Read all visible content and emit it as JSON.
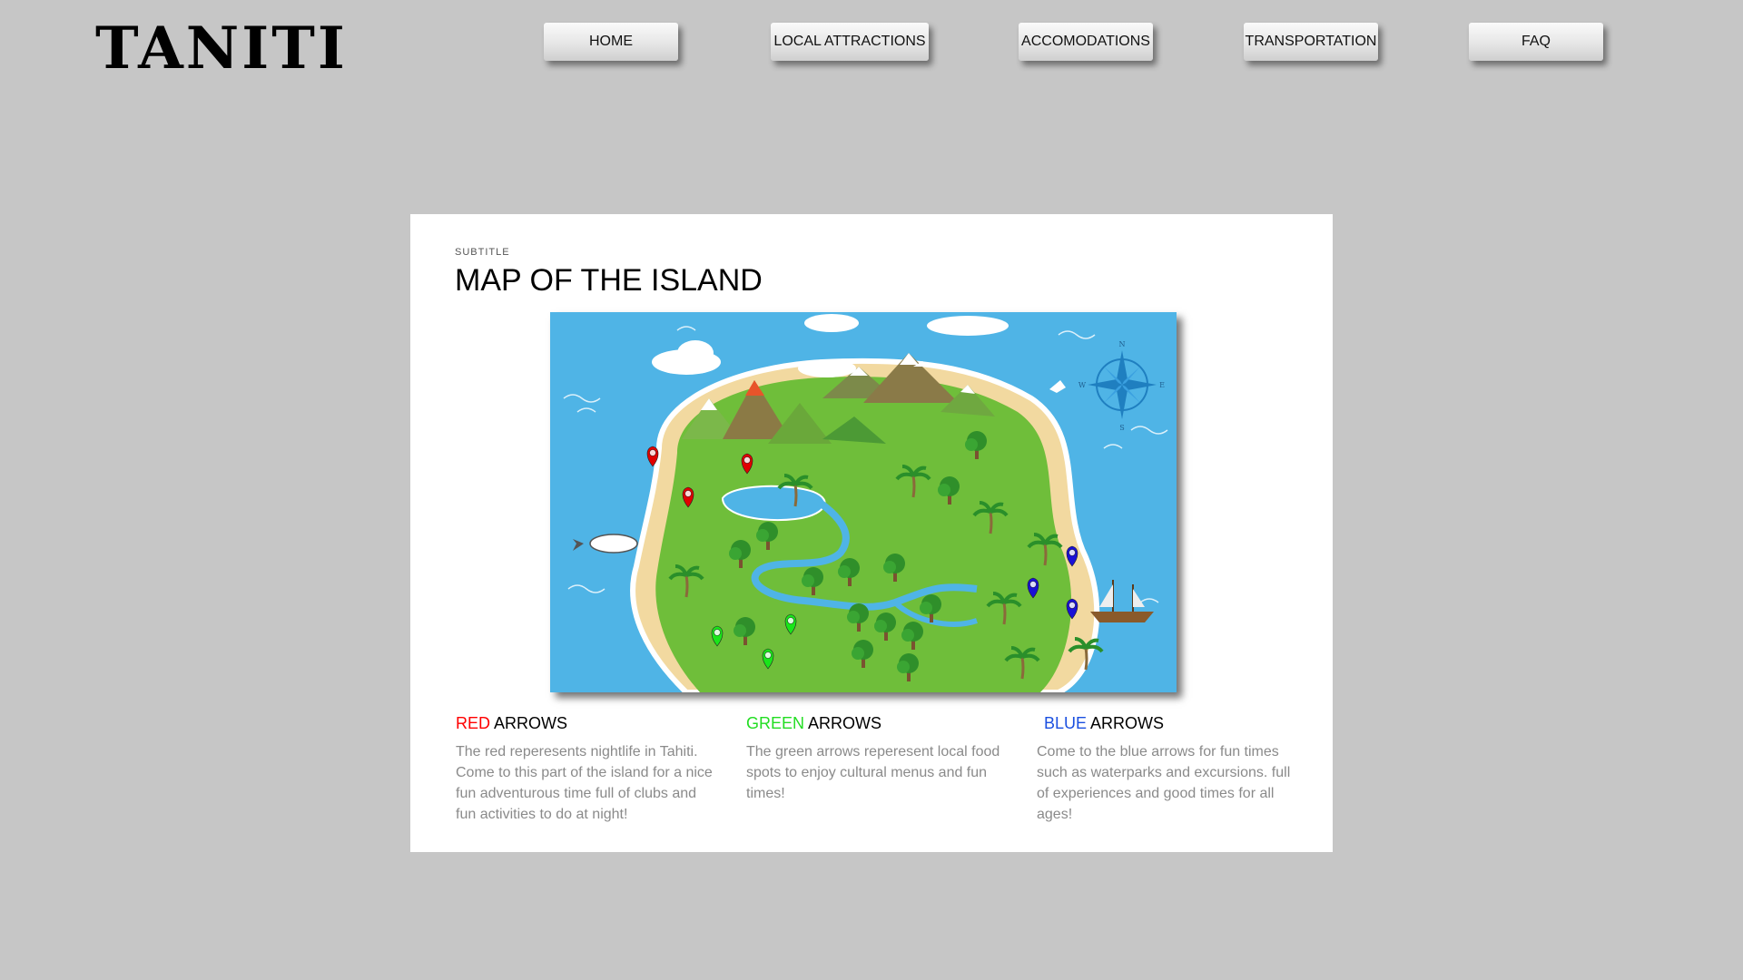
{
  "logo": "TANITI",
  "nav": {
    "home": "HOME",
    "attractions": "LOCAL ATTRACTIONS",
    "accomodations": "ACCOMODATIONS",
    "transportation": "TRANSPORTATION",
    "faq": "FAQ"
  },
  "card": {
    "subtitle": "SUBTITLE",
    "title": "MAP OF THE ISLAND"
  },
  "map": {
    "compass": {
      "n": "N",
      "s": "S",
      "e": "E",
      "w": "W"
    },
    "pin_colors": {
      "red": "#e00000",
      "green": "#19e619",
      "blue": "#1a10d6"
    }
  },
  "legend": {
    "arrows_word": "ARROWS",
    "red": {
      "color_word": "RED",
      "color": "#ff0000",
      "text": "The red reperesents nightlife in Tahiti. Come to this part of the island for a nice fun adventurous time full of clubs and fun activities to do at night!"
    },
    "green": {
      "color_word": "GREEN",
      "color": "#22dd22",
      "text": "The green arrows reperesent local food spots to enjoy cultural menus and fun times!"
    },
    "blue": {
      "color_word": "BLUE",
      "color": "#1a4fe0",
      "text": "Come to the blue arrows for fun times such as waterparks and excursions. full of experiences and good times for all ages!"
    }
  }
}
